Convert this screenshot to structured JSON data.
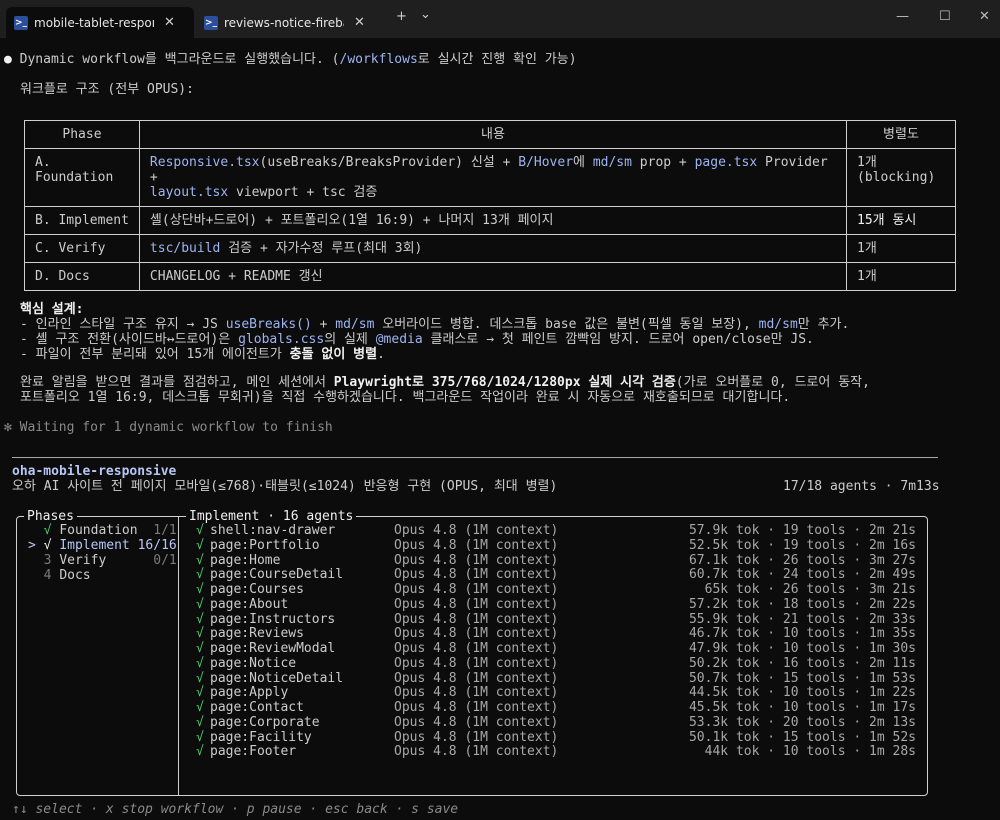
{
  "tabs": [
    {
      "label": "mobile-tablet-responsive-re",
      "active": true
    },
    {
      "label": "reviews-notice-firebase-mig",
      "active": false
    }
  ],
  "toolbar": {
    "new_tab": "+",
    "dropdown": "⌄"
  },
  "window_controls": {
    "minimize": "—",
    "maximize": "☐",
    "close": "✕"
  },
  "intro": {
    "bullet": "●",
    "p1": " Dynamic workflow를 백그라운드로 실행했습니다. (",
    "p2": "/workflows",
    "p3": "로 실시간 진행 확인 가능)",
    "structure": "워크플로 구조 (전부 OPUS):"
  },
  "table": {
    "headers": [
      "Phase",
      "내용",
      "병렬도"
    ],
    "rows": [
      {
        "phase": "A.\nFoundation",
        "content": [
          [
            "Responsive.tsx",
            true
          ],
          [
            "(useBreaks/BreaksProvider) 신설 + ",
            false
          ],
          [
            "B/Hover",
            true
          ],
          [
            "에 ",
            false
          ],
          [
            "md/sm",
            true
          ],
          [
            " prop + ",
            false
          ],
          [
            "page.tsx",
            true
          ],
          [
            " Provider +\n",
            false
          ],
          [
            "layout.tsx",
            true
          ],
          [
            " viewport + tsc 검증",
            false
          ]
        ],
        "parallel": "1개\n(blocking)",
        "bold": false
      },
      {
        "phase": "B. Implement",
        "content": [
          [
            "셸(상단바+드로어) + 포트폴리오(1열 16:9) + 나머지 13개 페이지",
            false
          ]
        ],
        "parallel": "15개 동시",
        "bold": true
      },
      {
        "phase": "C. Verify",
        "content": [
          [
            "tsc/build",
            true
          ],
          [
            " 검증 + 자가수정 루프(최대 3회)",
            false
          ]
        ],
        "parallel": "1개",
        "bold": false
      },
      {
        "phase": "D. Docs",
        "content": [
          [
            "CHANGELOG + README 갱신",
            false
          ]
        ],
        "parallel": "1개",
        "bold": false
      }
    ]
  },
  "design": {
    "title": "핵심 설계:",
    "l1": [
      [
        "- 인라인 스타일 구조 유지 → JS ",
        false
      ],
      [
        "useBreaks()",
        true
      ],
      [
        " + ",
        false
      ],
      [
        "md/sm",
        true
      ],
      [
        " 오버라이드 병합. 데스크톱 base 값은 불변(픽셀 동일 보장), ",
        false
      ],
      [
        "md/sm",
        true
      ],
      [
        "만 추가.",
        false
      ]
    ],
    "l2": [
      [
        "- 셸 구조 전환(사이드바↔드로어)은 ",
        false
      ],
      [
        "globals.css",
        true
      ],
      [
        "의 실제 ",
        false
      ],
      [
        "@media",
        true
      ],
      [
        " 클래스로 → 첫 페인트 깜빡임 방지. 드로어 open/close만 JS.",
        false
      ]
    ],
    "l3a": "- 파일이 전부 분리돼 있어 15개 에이전트가 ",
    "l3b": "충돌 없이 병렬",
    "l3c": "."
  },
  "closing": {
    "l1a": "완료 알림을 받으면 결과를 점검하고, 메인 세션에서 ",
    "l1b": "Playwright로 375/768/1024/1280px 실제 시각 검증",
    "l1c": "(가로 오버플로 0, 드로어 동작,",
    "l2": "포트폴리오 1열 16:9, 데스크톱 무회귀)을 직접 수행하겠습니다. 백그라운드 작업이라 완료 시 자동으로 재호출되므로 대기합니다."
  },
  "waiting": "✻ Waiting for 1 dynamic workflow to finish",
  "workflow": {
    "name": "oha-mobile-responsive",
    "description": "오하 AI 사이트 전 페이지 모바일(≤768)·태블릿(≤1024) 반응형 구현 (OPUS, 최대 병렬)",
    "status": "17/18 agents · 7m13s"
  },
  "phases_panel": {
    "title": "Phases",
    "items": [
      {
        "marker": "  ",
        "icon": "√",
        "name": "Foundation",
        "count": "1/1",
        "state": "done"
      },
      {
        "marker": "> ",
        "icon": "√",
        "name": "Implement",
        "count": "16/16",
        "state": "selected"
      },
      {
        "marker": "  ",
        "icon": "3",
        "name": "Verify",
        "count": "0/1",
        "state": "pending"
      },
      {
        "marker": "  ",
        "icon": "4",
        "name": "Docs",
        "count": "",
        "state": "pending"
      }
    ]
  },
  "agents_panel": {
    "title": "Implement · 16 agents",
    "agents": [
      {
        "name": "shell:nav-drawer",
        "model": "Opus 4.8 (1M context)",
        "tok": "57.9k tok",
        "tools": "19 tools",
        "time": "2m 21s"
      },
      {
        "name": "page:Portfolio",
        "model": "Opus 4.8 (1M context)",
        "tok": "52.5k tok",
        "tools": "19 tools",
        "time": "2m 16s"
      },
      {
        "name": "page:Home",
        "model": "Opus 4.8 (1M context)",
        "tok": "67.1k tok",
        "tools": "26 tools",
        "time": "3m 27s"
      },
      {
        "name": "page:CourseDetail",
        "model": "Opus 4.8 (1M context)",
        "tok": "60.7k tok",
        "tools": "24 tools",
        "time": "2m 49s"
      },
      {
        "name": "page:Courses",
        "model": "Opus 4.8 (1M context)",
        "tok": "65k tok",
        "tools": "26 tools",
        "time": "3m 21s"
      },
      {
        "name": "page:About",
        "model": "Opus 4.8 (1M context)",
        "tok": "57.2k tok",
        "tools": "18 tools",
        "time": "2m 22s"
      },
      {
        "name": "page:Instructors",
        "model": "Opus 4.8 (1M context)",
        "tok": "55.9k tok",
        "tools": "21 tools",
        "time": "2m 33s"
      },
      {
        "name": "page:Reviews",
        "model": "Opus 4.8 (1M context)",
        "tok": "46.7k tok",
        "tools": "10 tools",
        "time": "1m 35s"
      },
      {
        "name": "page:ReviewModal",
        "model": "Opus 4.8 (1M context)",
        "tok": "47.9k tok",
        "tools": "10 tools",
        "time": "1m 30s"
      },
      {
        "name": "page:Notice",
        "model": "Opus 4.8 (1M context)",
        "tok": "50.2k tok",
        "tools": "16 tools",
        "time": "2m 11s"
      },
      {
        "name": "page:NoticeDetail",
        "model": "Opus 4.8 (1M context)",
        "tok": "50.7k tok",
        "tools": "15 tools",
        "time": "1m 53s"
      },
      {
        "name": "page:Apply",
        "model": "Opus 4.8 (1M context)",
        "tok": "44.5k tok",
        "tools": "10 tools",
        "time": "1m 22s"
      },
      {
        "name": "page:Contact",
        "model": "Opus 4.8 (1M context)",
        "tok": "45.5k tok",
        "tools": "10 tools",
        "time": "1m 17s"
      },
      {
        "name": "page:Corporate",
        "model": "Opus 4.8 (1M context)",
        "tok": "53.3k tok",
        "tools": "20 tools",
        "time": "2m 13s"
      },
      {
        "name": "page:Facility",
        "model": "Opus 4.8 (1M context)",
        "tok": "50.1k tok",
        "tools": "15 tools",
        "time": "1m 52s"
      },
      {
        "name": "page:Footer",
        "model": "Opus 4.8 (1M context)",
        "tok": "44k tok",
        "tools": "10 tools",
        "time": "1m 28s"
      }
    ],
    "check_icon": "√",
    "sep": "·"
  },
  "footer": "↑↓ select · x stop workflow · p pause · esc back · s save",
  "colors": {
    "highlight": "#9db4f2",
    "success": "#4ec96b",
    "background": "#0c0c0c"
  }
}
